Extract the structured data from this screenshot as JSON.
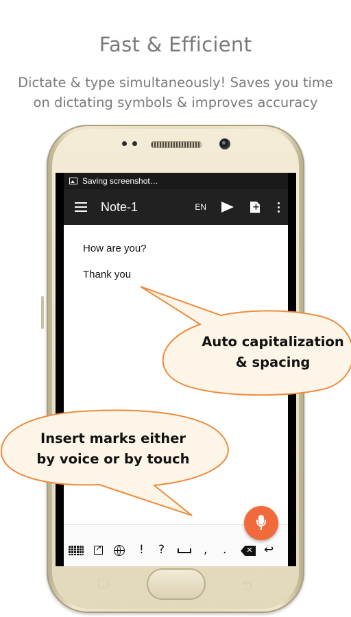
{
  "promo": {
    "headline": "Fast & Efficient",
    "subline_1": "Dictate & type simultaneously! Saves you time",
    "subline_2": "on dictating symbols & improves accuracy"
  },
  "status_bar": {
    "notification": "Saving screenshot…"
  },
  "toolbar": {
    "menu_icon": "hamburger-icon",
    "title": "Note-1",
    "language": "EN",
    "send_icon": "send-icon",
    "new_note_icon": "new-document-icon",
    "overflow_icon": "more-vert-icon"
  },
  "note": {
    "lines": [
      "How are you?",
      "Thank you"
    ]
  },
  "callouts": {
    "top_1": "Auto capitalization",
    "top_2": "& spacing",
    "bottom_1": "Insert marks either",
    "bottom_2": "by voice or by touch",
    "fill": "#fdf6e8",
    "stroke": "#f08a3c"
  },
  "keyboard_bar": {
    "keys": [
      "!",
      "?",
      ",",
      "."
    ],
    "keyboard_icon": "keyboard-icon",
    "external_icon": "open-external-icon",
    "globe_icon": "globe-icon",
    "space_icon": "space-icon",
    "backspace_icon": "backspace-icon",
    "enter_icon": "enter-icon",
    "enter_glyph": "↩"
  },
  "fab": {
    "icon": "microphone-icon",
    "color": "#f06a3c"
  }
}
